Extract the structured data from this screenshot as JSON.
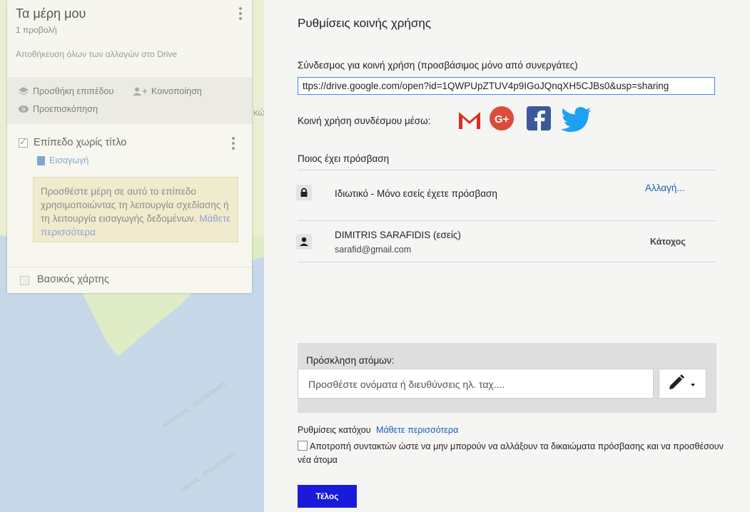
{
  "left_panel": {
    "map_title": "Τα μέρη μου",
    "views": "1 προβολή",
    "save_status": "Αποθήκευση όλων των αλλαγών στο Drive",
    "add_layer": "Προσθήκη επιπέδου",
    "share": "Κοινοποίηση",
    "preview": "Προεπισκόπηση",
    "layer_title": "Επίπεδο χωρίς τίτλο",
    "import": "Εισαγωγή",
    "tip_text": "Προσθέστε μέρη σε αυτό το επίπεδο χρησιμοποιώντας τη λειτουργία σχεδίασης ή τη λειτουργία εισαγωγής δεδομένων.",
    "tip_link": "Μάθετε περισσότερα",
    "base_map": "Βασικός χάρτης"
  },
  "map": {
    "stray_text": "κώ",
    "labels": [
      "Αλόννησος - Θεσσαλονίκη",
      "Λήμνος - Θεσσαλονίκη"
    ]
  },
  "dialog": {
    "title": "Ρυθμίσεις κοινής χρήσης",
    "link_label": "Σύνδεσμος για κοινή χρήση (προσβάσιμος μόνο από συνεργάτες)",
    "link_value": "ttps://drive.google.com/open?id=1QWPUpZTUV4p9IGoJQnqXH5CJBs0&usp=sharing",
    "share_via": "Κοινή χρήση συνδέσμου μέσω:",
    "social": [
      "gmail-icon",
      "google-plus-icon",
      "facebook-icon",
      "twitter-icon"
    ],
    "who_has_access": "Ποιος έχει πρόσβαση",
    "access_text": "Ιδιωτικό - Μόνο εσείς έχετε πρόσβαση",
    "change_link": "Αλλαγή...",
    "owner_name": "DIMITRIS SARAFIDIS (εσείς)",
    "owner_email": "sarafid@gmail.com",
    "owner_role": "Κάτοχος",
    "invite_label": "Πρόσκληση ατόμων:",
    "invite_placeholder": "Προσθέστε ονόματα ή διευθύνσεις ηλ. ταχ....",
    "owner_settings": "Ρυθμίσεις κατόχου",
    "owner_settings_link": "Μάθετε περισσότερα",
    "restrict_text": "Αποτροπή συντακτών ώστε να μην μπορούν να αλλάξουν τα δικαιώματα πρόσβασης και να προσθέσουν νέα άτομα",
    "done": "Τέλος"
  },
  "colors": {
    "accent_blue": "#1a1adb",
    "link_blue": "#1a5eb8",
    "gmail_red": "#d93025",
    "gplus_red": "#dd4b39",
    "facebook": "#3b5998",
    "twitter": "#1da1f2"
  }
}
